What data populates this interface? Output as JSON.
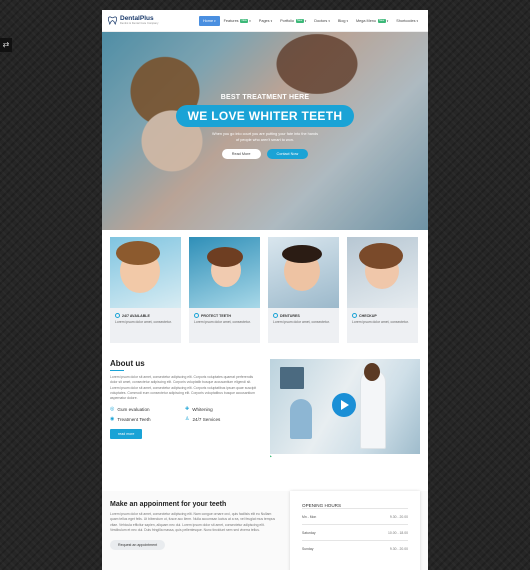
{
  "header": {
    "logo_name": "DentalPlus",
    "logo_tagline": "Dentist & Dental Care Company",
    "nav": [
      {
        "label": "Home",
        "active": true,
        "caret": "▾"
      },
      {
        "label": "Features",
        "badge": "New",
        "caret": "▾"
      },
      {
        "label": "Pages",
        "caret": "▾"
      },
      {
        "label": "Portfolio",
        "badge": "New",
        "caret": "▾"
      },
      {
        "label": "Doctors",
        "caret": "▾"
      },
      {
        "label": "Blog",
        "caret": "▾"
      },
      {
        "label": "Mega Menu",
        "badge": "New",
        "caret": "▾"
      },
      {
        "label": "Shortcodes",
        "caret": "▾"
      }
    ]
  },
  "hero": {
    "subtitle": "BEST TREATMENT HERE",
    "title": "WE LOVE WHITER TEETH",
    "text": "When you go into court you are putting your fate into the hands of people who aren't smart to won.",
    "btn_read_more": "Read More",
    "btn_contact": "Contact Now"
  },
  "services": [
    {
      "title": "24/7 AVAILABLE",
      "text": "Lorem ipsum dolor amet, consectetur."
    },
    {
      "title": "PROTECT TEETH",
      "text": "Lorem ipsum dolor amet, consectetur."
    },
    {
      "title": "DENTURES",
      "text": "Lorem ipsum dolor amet, consectetur."
    },
    {
      "title": "CHECKUP",
      "text": "Lorem ipsum dolor amet, consectetur."
    }
  ],
  "about": {
    "title": "About us",
    "text": "Lorem ipsum dolor sit amet, consectetur adipiscing elit. Corporis voluptates quaerat perferendis dolor sit amet, consectetur adipiscing elit. Corporis voluptatib busque accusantium eligendi sit. Lorem ipsum dolor sit amet, consectetur adipiscing elit. Corporis voluptatibus ipsum quae suscipit voluptates. Commodi eum consectetur adipiscing elit. Corporis voluptatibus busque accusantium aspernatur dolore.",
    "features": [
      {
        "label": "Gum evaluation",
        "icon": "◎"
      },
      {
        "label": "Whitening",
        "icon": "✚"
      },
      {
        "label": "Treatment Teeth",
        "icon": "◉"
      },
      {
        "label": "24/7 Services",
        "icon": "♙"
      }
    ],
    "read_more": "read more",
    "video_caption": "▶"
  },
  "appointment": {
    "title": "Make an appoinment for your teeth",
    "text": "Lorem ipsum dolor sit amet, consectetur adipiscing elit. Nam congue ornare orci, quis facilisis elit eu Nullam quam tellus eget felis. Ut bibendum ut, fusce acc ilerm. Nulla accumsan luctus at a ea, vel feugiat mus tempus vitae. Vehicula efficitur sapien, aliquam nec dui. Lorem ipsum dolor sit amet, consectetur adipiscing elit. Vestibulum et nec dui. Duis fringilla massa, quis pellentesque. Nunc tincidunt sem sed viverra tellus.",
    "button": "Request an appointment",
    "hours_title": "OPENING HOURS",
    "hours": [
      {
        "day": "Mn - Mon",
        "time": "9.30 - 20.00"
      },
      {
        "day": "Saturday",
        "time": "10.00 - 18.00"
      },
      {
        "day": "Sunday",
        "time": "9.30 - 20.00"
      }
    ]
  }
}
